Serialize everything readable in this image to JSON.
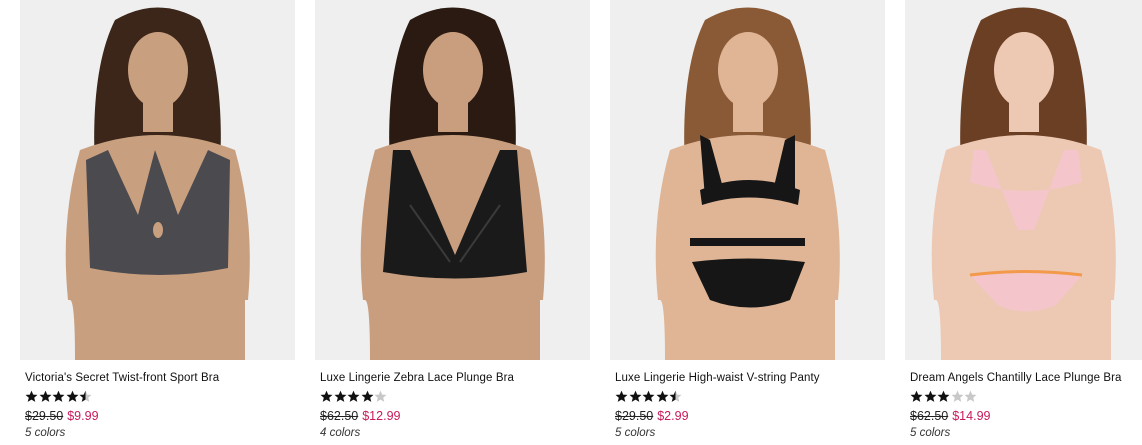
{
  "products": [
    {
      "name": "Victoria's Secret Twist-front Sport Bra",
      "rating": 4.5,
      "rating_max": 5,
      "was_price": "$29.50",
      "sale_price": "$9.99",
      "colors": "5 colors",
      "image_desc": "model-charcoal-sport-bra",
      "garment_color": "#4b4a4f",
      "skin_color": "#c9a07f",
      "hair_color": "#3b2619"
    },
    {
      "name": "Luxe Lingerie Zebra Lace Plunge Bra",
      "rating": 4,
      "rating_max": 5,
      "was_price": "$62.50",
      "sale_price": "$12.99",
      "colors": "4 colors",
      "image_desc": "model-black-lace-plunge-bra",
      "garment_color": "#1a1a1a",
      "skin_color": "#c89e7e",
      "hair_color": "#2a1a12"
    },
    {
      "name": "Luxe Lingerie High-waist V-string Panty",
      "rating": 4.5,
      "rating_max": 5,
      "was_price": "$29.50",
      "sale_price": "$2.99",
      "colors": "5 colors",
      "image_desc": "model-black-high-waist-panty",
      "garment_color": "#161616",
      "skin_color": "#e0b596",
      "hair_color": "#8a5a37"
    },
    {
      "name": "Dream Angels Chantilly Lace Plunge Bra",
      "rating": 3,
      "rating_max": 5,
      "was_price": "$62.50",
      "sale_price": "$14.99",
      "colors": "5 colors",
      "image_desc": "model-pink-lace-plunge-bra",
      "garment_color": "#f4c6cc",
      "skin_color": "#edc9b4",
      "hair_color": "#6b3f24"
    }
  ],
  "colors": {
    "sale_price": "#c8195a",
    "photo_background": "#efefef",
    "star_filled": "#111111",
    "star_empty": "#c8c8c8"
  }
}
